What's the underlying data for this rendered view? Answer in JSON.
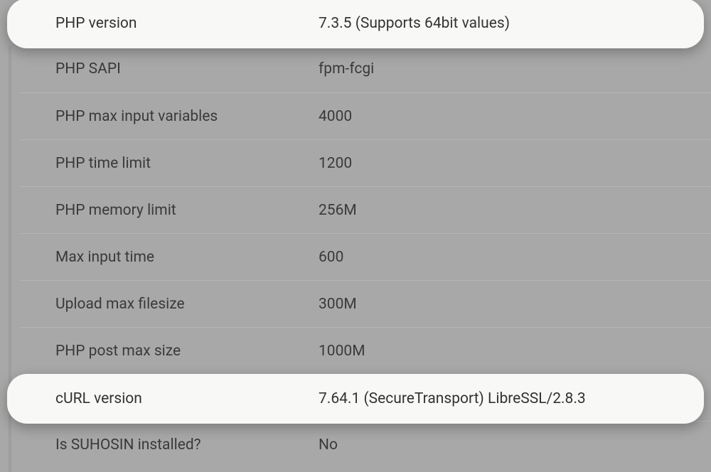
{
  "rows": [
    {
      "label": "PHP version",
      "value": "7.3.5 (Supports 64bit values)",
      "highlight": true
    },
    {
      "label": "PHP SAPI",
      "value": "fpm-fcgi",
      "highlight": false
    },
    {
      "label": "PHP max input variables",
      "value": "4000",
      "highlight": false
    },
    {
      "label": "PHP time limit",
      "value": "1200",
      "highlight": false
    },
    {
      "label": "PHP memory limit",
      "value": "256M",
      "highlight": false
    },
    {
      "label": "Max input time",
      "value": "600",
      "highlight": false
    },
    {
      "label": "Upload max filesize",
      "value": "300M",
      "highlight": false
    },
    {
      "label": "PHP post max size",
      "value": "1000M",
      "highlight": false
    },
    {
      "label": "cURL version",
      "value": "7.64.1 (SecureTransport) LibreSSL/2.8.3",
      "highlight": true
    },
    {
      "label": "Is SUHOSIN installed?",
      "value": "No",
      "highlight": false
    }
  ]
}
